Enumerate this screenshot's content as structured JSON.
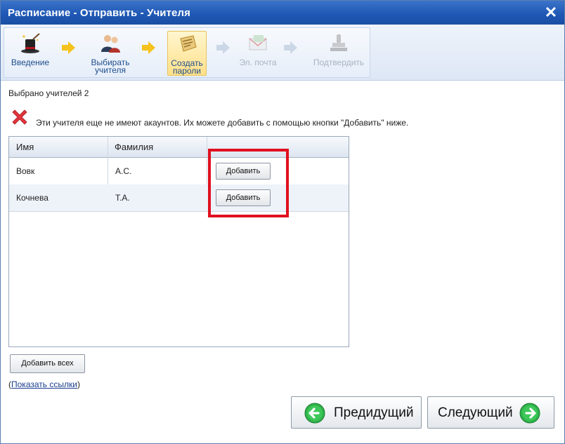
{
  "window": {
    "title": "Расписание - Отправить - Учителя",
    "close_glyph": "✕"
  },
  "wizard": {
    "steps": [
      {
        "label": "Введение",
        "icon": "magic-hat-icon",
        "state": "done"
      },
      {
        "label": "Выбирать учителя",
        "icon": "users-icon",
        "state": "done"
      },
      {
        "label": "Создать пароли",
        "icon": "password-icon",
        "state": "active"
      },
      {
        "label": "Эл. почта",
        "icon": "email-icon",
        "state": "disabled"
      },
      {
        "label": "Подтвердить",
        "icon": "stamp-icon",
        "state": "disabled"
      }
    ]
  },
  "selected_text": "Выбрано учителей 2",
  "warning_text": "Эти учителя еще не имеют акаунтов. Их можете добавить с помощью кнопки \"Добавить\" ниже.",
  "table": {
    "columns": [
      "Имя",
      "Фамилия",
      ""
    ],
    "rows": [
      {
        "first": "Вовк",
        "last": "A.C.",
        "action": "Добавить"
      },
      {
        "first": "Кочнева",
        "last": "T.A.",
        "action": "Добавить"
      }
    ]
  },
  "add_all_label": "Добавить всех",
  "links": {
    "open": "(",
    "label": "Показать ссылки",
    "close": ")"
  },
  "nav": {
    "prev_label": "Предидущий",
    "next_label": "Следующий"
  },
  "colors": {
    "title_bar": "#1e57b4",
    "highlight": "#e0101f",
    "arrow_green": "#2fb24a",
    "step_arrow": "#f6c21c"
  }
}
